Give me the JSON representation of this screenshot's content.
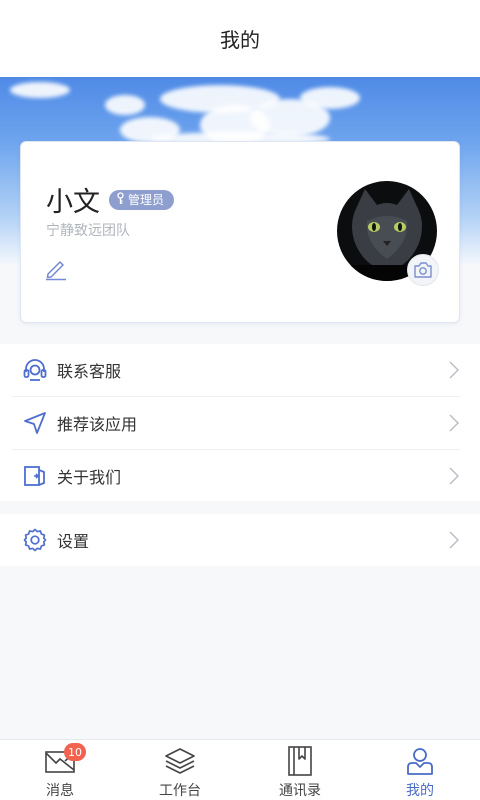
{
  "header": {
    "title": "我的"
  },
  "profile": {
    "name": "小文",
    "role_badge": "管理员",
    "team": "宁静致远团队"
  },
  "menu": {
    "group1": [
      {
        "label": "联系客服",
        "icon": "headset-icon"
      },
      {
        "label": "推荐该应用",
        "icon": "navigation-arrow-icon"
      },
      {
        "label": "关于我们",
        "icon": "about-door-icon"
      }
    ],
    "group2": [
      {
        "label": "设置",
        "icon": "gear-icon"
      }
    ]
  },
  "tabbar": {
    "tabs": [
      {
        "label": "消息",
        "icon": "mail-icon",
        "badge": "10"
      },
      {
        "label": "工作台",
        "icon": "layers-icon"
      },
      {
        "label": "通讯录",
        "icon": "contacts-book-icon"
      },
      {
        "label": "我的",
        "icon": "user-icon",
        "active": true
      }
    ]
  },
  "colors": {
    "accent": "#4a6cc7",
    "icon_blue": "#4f6fcf",
    "badge_red": "#f1634f",
    "role_badge_bg": "#8e9fcf"
  }
}
